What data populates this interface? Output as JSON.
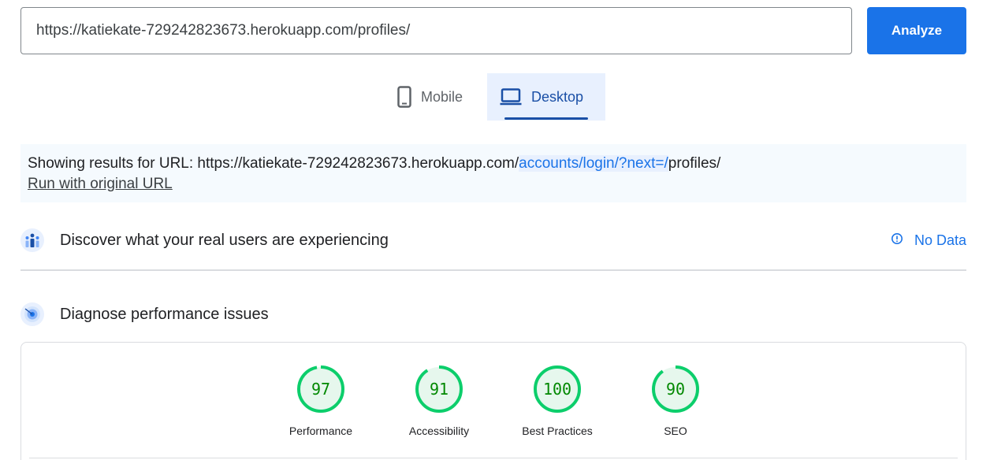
{
  "search": {
    "url_value": "https://katiekate-729242823673.herokuapp.com/profiles/",
    "analyze_label": "Analyze"
  },
  "device_tabs": {
    "mobile_label": "Mobile",
    "desktop_label": "Desktop",
    "selected": "Desktop"
  },
  "results": {
    "prefix": "Showing results for URL: https://katiekate-729242823673.herokuapp.com/",
    "redirect_part": "accounts/login/?next=/",
    "suffix": "profiles/",
    "run_original_label": "Run with original URL"
  },
  "discover": {
    "title": "Discover what your real users are experiencing",
    "no_data_label": "No Data"
  },
  "diagnose": {
    "title": "Diagnose performance issues"
  },
  "scores": [
    {
      "label": "Performance",
      "score": "97",
      "value": 97
    },
    {
      "label": "Accessibility",
      "score": "91",
      "value": 91
    },
    {
      "label": "Best Practices",
      "score": "100",
      "value": 100
    },
    {
      "label": "SEO",
      "score": "90",
      "value": 90
    }
  ],
  "colors": {
    "accent": "#1a73e8",
    "pass_green": "#0cce6b",
    "pass_fill": "#e6f7ed",
    "score_text": "#008800"
  },
  "icons": {
    "mobile": "smartphone-icon",
    "desktop": "laptop-icon",
    "discover": "users-icon",
    "diagnose": "radar-icon",
    "no_data": "info-icon"
  }
}
